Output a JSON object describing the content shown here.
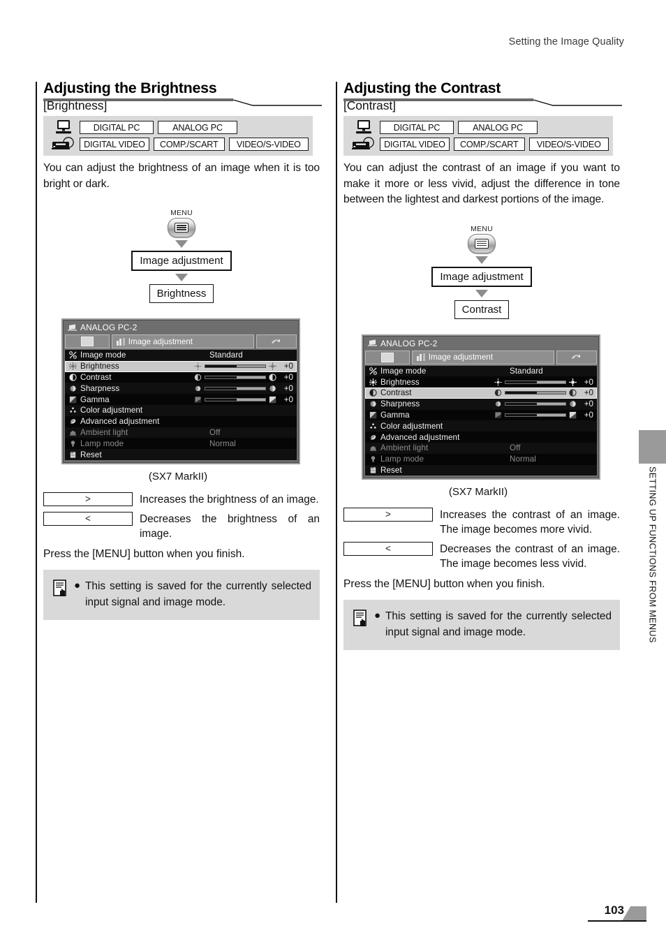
{
  "page": {
    "running_head": "Setting the Image Quality",
    "page_number": "103",
    "side_tab_label": "SETTING UP FUNCTIONS FROM MENUS"
  },
  "shared": {
    "signal_badges": {
      "row_pc": [
        "DIGITAL PC",
        "ANALOG PC"
      ],
      "row_video": [
        "DIGITAL VIDEO",
        "COMP./SCART",
        "VIDEO/S-VIDEO"
      ],
      "icon_pc": "monitor-icon",
      "icon_video": "video-deck-icon"
    },
    "flow": {
      "menu_label": "MENU",
      "menu_button_icon": "menu-button-icon",
      "step1": "Image adjustment"
    },
    "osd": {
      "signal_title": "ANALOG PC-2",
      "signal_icon": "projector-input-icon",
      "tab_left_icon": "screen-tab-icon",
      "tab_center_icon": "image-adjust-tab-icon",
      "tab_center_label": "Image adjustment",
      "tab_right_icon": "install-tab-icon",
      "rows": [
        {
          "icon": "image-mode-icon",
          "name": "Image mode",
          "value": "Standard",
          "type": "value",
          "dim": false
        },
        {
          "icon": "brightness-icon",
          "name": "Brightness",
          "value": "+0",
          "type": "slider",
          "fill": 52,
          "dim": false
        },
        {
          "icon": "contrast-icon",
          "name": "Contrast",
          "value": "+0",
          "type": "slider",
          "fill": 52,
          "dim": false
        },
        {
          "icon": "sharpness-icon",
          "name": "Sharpness",
          "value": "+0",
          "type": "slider",
          "fill": 52,
          "dim": false
        },
        {
          "icon": "gamma-icon",
          "name": "Gamma",
          "value": "+0",
          "type": "slider",
          "fill": 52,
          "dim": false
        },
        {
          "icon": "color-adjustment-icon",
          "name": "Color adjustment",
          "value": "",
          "type": "value",
          "dim": false
        },
        {
          "icon": "advanced-adjustment-icon",
          "name": "Advanced adjustment",
          "value": "",
          "type": "value",
          "dim": false
        },
        {
          "icon": "ambient-light-icon",
          "name": "Ambient light",
          "value": "Off",
          "type": "value",
          "dim": true
        },
        {
          "icon": "lamp-mode-icon",
          "name": "Lamp mode",
          "value": "Normal",
          "type": "value",
          "dim": true
        },
        {
          "icon": "reset-icon",
          "name": "Reset",
          "value": "",
          "type": "value",
          "dim": false
        }
      ]
    },
    "caption": "(SX7 MarkII)",
    "press_menu": "Press the [MENU] button when you finish.",
    "note": {
      "icon": "note-memo-icon",
      "bullet": "●",
      "text": "This setting is saved for the currently selected input signal and image mode."
    },
    "key_increase": ">",
    "key_decrease": "<"
  },
  "left_column": {
    "title": "Adjusting the Brightness",
    "subtitle": "[Brightness]",
    "description": "You can adjust the brightness of an image when it is too bright or dark.",
    "flow_step2": "Brightness",
    "selected_osd_row": 1,
    "keys": [
      {
        "label": ">",
        "desc": "Increases the brightness of an image."
      },
      {
        "label": "<",
        "desc": "Decreases the brightness of an image."
      }
    ]
  },
  "right_column": {
    "title": "Adjusting the Contrast",
    "subtitle": "[Contrast]",
    "description": "You can adjust the contrast of an image if you want to make it more or less vivid, adjust the difference in tone between the lightest and darkest portions of the image.",
    "flow_step2": "Contrast",
    "selected_osd_row": 2,
    "keys": [
      {
        "label": ">",
        "desc": "Increases the contrast of an image. The image becomes more vivid."
      },
      {
        "label": "<",
        "desc": "Decreases the contrast of an image. The image becomes less vivid."
      }
    ]
  },
  "colors": {
    "badge_panel_bg": "#d9d9d9",
    "note_bg": "#d9d9d9",
    "side_tab_gray": "#9a9a9a",
    "osd_bezel": "#6e6e6e",
    "osd_list_bg": "#101010",
    "osd_selected_bg": "#c9c9c9"
  }
}
